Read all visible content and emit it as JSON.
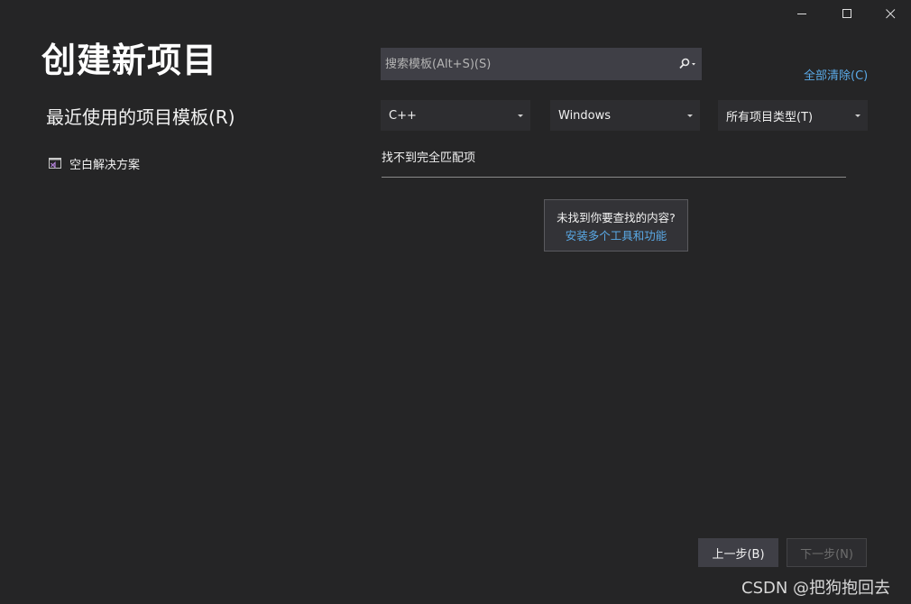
{
  "window_controls": {
    "minimize": "minimize",
    "maximize": "maximize",
    "close": "close"
  },
  "page": {
    "title": "创建新项目"
  },
  "recent": {
    "heading": "最近使用的项目模板(R)",
    "items": [
      {
        "label": "空白解决方案",
        "icon": "blank-solution-icon"
      }
    ]
  },
  "search": {
    "placeholder": "搜索模板(Alt+S)(S)",
    "value": "",
    "icon": "search-icon"
  },
  "clear_all": "全部清除(C)",
  "filters": {
    "language": "C++",
    "platform": "Windows",
    "project_type": "所有项目类型(T)"
  },
  "results": {
    "no_match": "找不到完全匹配项"
  },
  "hint": {
    "question": "未找到你要查找的内容?",
    "link": "安装多个工具和功能"
  },
  "footer": {
    "back_label": "上一步(B)",
    "next_label": "下一步(N)"
  },
  "watermark": "CSDN @把狗抱回去",
  "colors": {
    "background": "#252526",
    "input": "#3f3f46",
    "link": "#5aa9e6",
    "icon_accent": "#b180d7"
  }
}
